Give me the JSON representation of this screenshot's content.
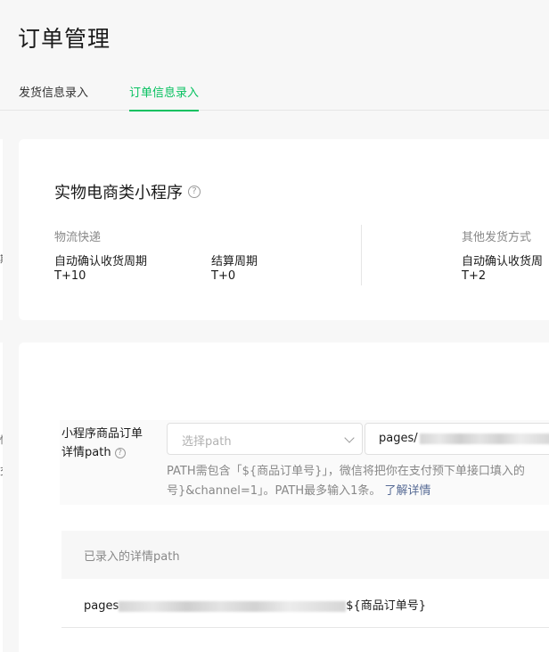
{
  "page": {
    "title": "订单管理"
  },
  "tabs": [
    {
      "label": "发货信息录入",
      "active": false
    },
    {
      "label": "订单信息录入",
      "active": true
    }
  ],
  "sidebar_fragments": [
    "期",
    "情",
    "交"
  ],
  "summary_card": {
    "title": "实物电商类小程序",
    "help_icon": "question-circle-icon",
    "groups": [
      {
        "title": "物流快递",
        "items": [
          {
            "label": "自动确认收货周期",
            "value": "T+10"
          },
          {
            "label": "结算周期",
            "value": "T+0"
          }
        ]
      },
      {
        "title": "其他发货方式",
        "items": [
          {
            "label": "自动确认收货周",
            "value": "T+2"
          }
        ]
      }
    ]
  },
  "path_form": {
    "label_line1": "小程序商品订单",
    "label_line2": "详情path",
    "select_placeholder": "选择path",
    "input_prefix": "pages/",
    "hint_line1": "PATH需包含「${商品订单号}」，微信将把你在支付预下单接口填入的",
    "hint_line2": "号}&channel=1」。PATH最多输入1条。",
    "hint_link": "了解详情"
  },
  "recorded_table": {
    "header": "已录入的详情path",
    "rows": [
      {
        "prefix": "pages",
        "suffix": "${商品订单号}"
      }
    ]
  },
  "colors": {
    "accent": "#07c160",
    "link": "#576b95",
    "muted": "#888888"
  }
}
